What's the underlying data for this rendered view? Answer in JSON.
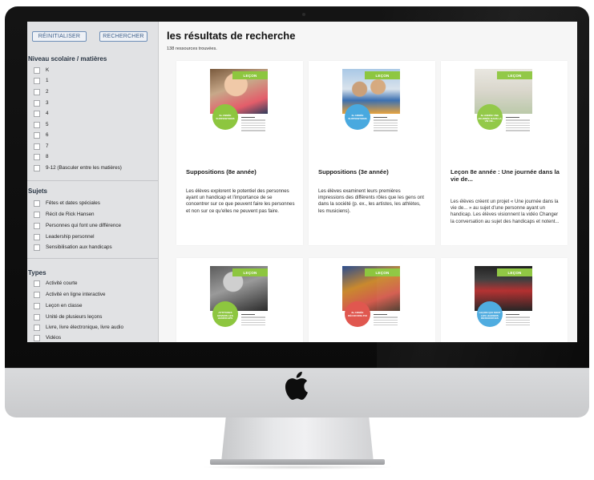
{
  "sidebar": {
    "reset_label": "RÉINITIALISER",
    "search_label": "RECHERCHER",
    "groups": [
      {
        "title": "Niveau scolaire / matières",
        "items": [
          "K",
          "1",
          "2",
          "3",
          "4",
          "5",
          "6",
          "7",
          "8",
          "9-12 (Basculer entre les matières)"
        ]
      },
      {
        "title": "Sujets",
        "items": [
          "Fêtes et dates spéciales",
          "Récit de Rick Hansen",
          "Personnes qui font une différence",
          "Leadership personnel",
          "Sensibilisation aux handicaps"
        ]
      },
      {
        "title": "Types",
        "items": [
          "Activité courte",
          "Activité en ligne interactive",
          "Leçon en classe",
          "Unité de plusieurs leçons",
          "Livre, livre électronique, livre audio",
          "Vidéos"
        ]
      }
    ]
  },
  "main": {
    "title": "les résultats de recherche",
    "count": "138 ressources trouvées.",
    "cards": [
      {
        "tag": "LEÇON",
        "thumb_caption": "8e ANNÉE SUPPOSITIONS",
        "title": "Suppositions (8e année)",
        "description": "Les élèves explorent le potentiel des personnes ayant un handicap et l'importance de se concentrer sur ce que peuvent faire les personnes et non sur ce qu'elles ne peuvent pas faire."
      },
      {
        "tag": "LEÇON",
        "thumb_caption": "3e ANNÉE SUPPOSITIONS",
        "title": "Suppositions (3e année)",
        "description": "Les élèves examinent leurs premières impressions des différents rôles que les gens ont dans la société (p. ex., les artistes, les athlètes, les musiciens)."
      },
      {
        "tag": "LEÇON",
        "thumb_caption": "8e ANNÉE UNE JOURNÉE DANS LA VIE DE...",
        "title": "Leçon 8e année : Une journée dans la vie de...",
        "description": "Les élèves créent un projet « Une journée dans la vie de... » au sujet d'une personne ayant un handicap. Les élèves visionnent la vidéo Changer la conversation au sujet des handicaps et notent..."
      },
      {
        "tag": "LEÇON",
        "thumb_caption": "ATTITUDES ENVERS LES HANDICAPS",
        "title": "",
        "description": ""
      },
      {
        "tag": "LEÇON",
        "thumb_caption": "8e ANNÉE DÉCOUVRE-TOI",
        "title": "",
        "description": ""
      },
      {
        "tag": "LEÇON",
        "thumb_caption": "LEÇON QUI SONT LES LEADERS RESSOURCES",
        "title": "",
        "description": ""
      }
    ]
  },
  "colors": {
    "tag_green": "#8dc63f",
    "button_blue": "#3e5f8a",
    "sidebar_bg": "#e1e2e4",
    "blob_green": "#8dc63f",
    "blob_blue": "#49a9df",
    "blob_red": "#e0574f"
  },
  "hardware": {
    "logo": "apple-logo-icon",
    "camera": "camera-dot-icon"
  }
}
